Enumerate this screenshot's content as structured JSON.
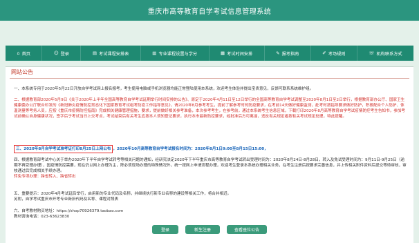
{
  "header": {
    "title": "重庆市高等教育自学考试信息管理系统"
  },
  "nav": [
    {
      "icon": "home-icon",
      "glyph": "⌂",
      "label": "首页"
    },
    {
      "icon": "user-icon",
      "glyph": "☺",
      "label": "登录"
    },
    {
      "icon": "calendar-icon",
      "glyph": "▤",
      "label": "考试课程安排表"
    },
    {
      "icon": "book-icon",
      "glyph": "▥",
      "label": "专业课程设置与学分"
    },
    {
      "icon": "table-icon",
      "glyph": "▦",
      "label": "考试时间安排"
    },
    {
      "icon": "signup-icon",
      "glyph": "✎",
      "label": "报考指南"
    },
    {
      "icon": "help-icon",
      "glyph": "✐",
      "label": "考场规则"
    },
    {
      "icon": "phone-icon",
      "glyph": "☏",
      "label": "机构联系方式"
    }
  ],
  "section": {
    "title": "网站公告"
  },
  "notices": {
    "n1": "一、本系统专用于2020年5月22日开放自学考试网上报名报考，考生使用电脑或手机浏览器均能正常登陆使用本系统，欢迎考生体验并提出宝贵意见，反馈可联系系统维护组。",
    "n2a": "二、根据教育部2020年5月9日《关于2020年上半年全国高等教育自学考试延期举行时间安排的公告》、原定于2020年4月11日至12日举行的全国高等教育自学考试调整至2020年8月1日至2日举行，根据教育部办公厅、国家卫生健康委办公厅联合印发的《新冠肺炎疫情防控常态化下国家教育考试组考防疫工作指导意见》，请2020年8月参考考生，提前了解参考时的防疫要求，在考前14天做好健康监测，赴考时按指导要求做好防护，积极配合个人防护、体温测量等考务人员，应按《重庆市疫情防控指南》完成相关健康管理措施，要求，提前做好相关参考准备，本次参考考生，在参考前，通过本系统考生信息区域，下载打印2020年8月高等教育自学考试疫情防控考生告知书，参加考试前确认自身健康状况，签字后于考试当日上交",
    "n2b": "考点，考试结束后有关考生应按本人须知登记要求，执行本市最新防控要求，经批准后方可离渝，违反有关规定者按有关考试规定处理，特此提醒。",
    "n3_highlight": "三、2020年8月自学考试准考证打印8月25日上网公布",
    "n3_rest": "，2020年10月高等教育自学考试报名时间为：2020年8月1日9:00至8月15日15:00，",
    "n4": "四、根据教育部考试中心关于举办2020年下半年自学考试转考等相关问题的通知，经研究决定2020年下半年重庆市高等教育自学考试转出受理时间为：2020年8月24日-8月28日，转入及免试受理时间为：9月11日-9月25日（逾期不再受理办理），因疫情防控需要，现在仍以网上办理为主，除必须现场办理的特殊情况外，统一按网上申请流程办理，欢迎考生登录本系统办理相关业务，在考生注册后按要求完善信息，并上传相关附件资料后提交等待审核，审核通过后完成相关手续办理。",
    "n4_red": "转免专项办理：跨省转入、跨省转出",
    "n5": "五、重要提示：2020年4月考试延后举行，启用新的专业代码及名称，并继续执行新专业名称的建设等相关工作，将合并相近。",
    "n5b": "另附，自学考试重庆市开考专业新旧代码及名称、课程对照表",
    "n6": "六、自考教材购买地址：https://shop70926379.taobao.com",
    "n6b": "教材咨询电话：023-63623830"
  },
  "buttons": {
    "login": "登录",
    "register": "新生注册",
    "seat": "查看座位公告"
  }
}
